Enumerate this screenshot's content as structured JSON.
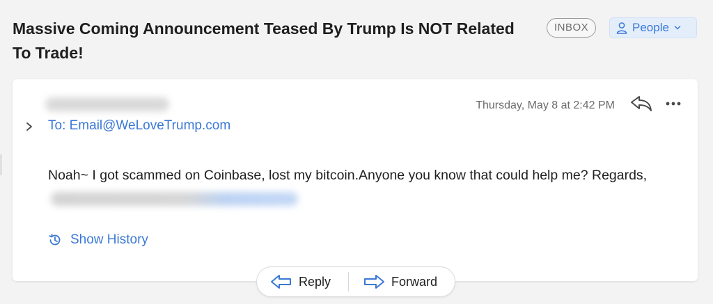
{
  "header": {
    "subject": "Massive Coming Announcement Teased By Trump Is NOT Related To Trade!",
    "mailbox_badge": "INBOX",
    "category_button": "People"
  },
  "message": {
    "timestamp": "Thursday, May 8 at 2:42 PM",
    "to_line": "To: Email@WeLoveTrump.com",
    "body": "Noah~ I got scammed on Coinbase, lost my bitcoin.Anyone you know that could help me? Regards,",
    "show_history": "Show History"
  },
  "actions": {
    "reply": "Reply",
    "forward": "Forward"
  },
  "icons": {
    "category": "person-icon",
    "category_dropdown": "chevron-down-icon",
    "reply": "reply-arrow-icon",
    "more": "ellipsis-icon",
    "expand": "chevron-right-icon",
    "history": "history-clock-icon",
    "forward": "forward-arrow-icon"
  },
  "colors": {
    "accent": "#3a78d6",
    "people_bg": "#e4eefb",
    "background": "#f3f3f3"
  }
}
